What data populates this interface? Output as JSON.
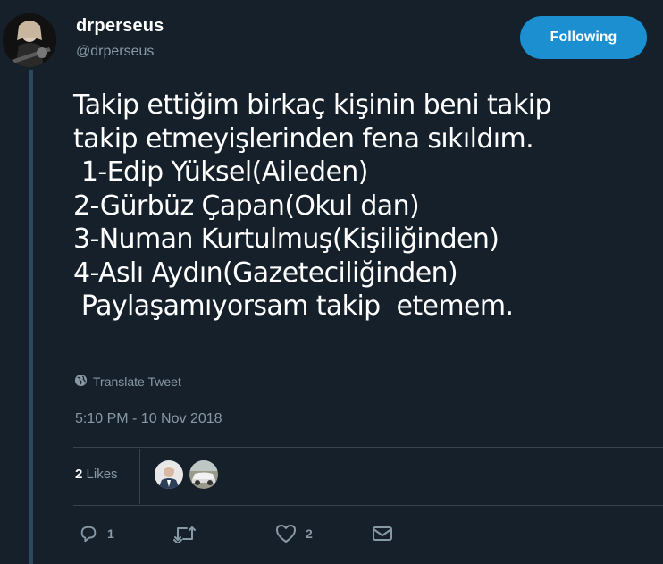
{
  "author": {
    "display_name": "drperseus",
    "handle": "@drperseus",
    "avatar": "avatar-photo-guitarist"
  },
  "follow_button": {
    "label": "Following",
    "color": "#1b8fd0"
  },
  "tweet": {
    "text": "Takip ettiğim birkaç kişinin beni takip\ntakip etmeyişlerinden fena sıkıldım.\n 1-Edip Yüksel(Aileden)\n2-Gürbüz Çapan(Okul dan)\n3-Numan Kurtulmuş(Kişiliğinden)\n4-Aslı Aydın(Gazeteciliğinden)\n Paylaşamıyorsam takip  etemem.",
    "translate_label": "Translate Tweet",
    "timestamp": "5:10 PM - 10 Nov 2018"
  },
  "likes": {
    "count": "2",
    "label": "Likes",
    "likers": [
      "liker-avatar-man",
      "liker-avatar-car"
    ]
  },
  "actions": {
    "reply": {
      "icon": "reply-icon",
      "count": "1"
    },
    "retweet": {
      "icon": "retweet-icon",
      "count": ""
    },
    "like": {
      "icon": "heart-icon",
      "count": "2"
    },
    "dm": {
      "icon": "envelope-icon"
    }
  },
  "colors": {
    "background": "#15202b",
    "secondary_text": "#8899a6",
    "divider": "#38444d",
    "thread_line": "#2b4a62"
  }
}
